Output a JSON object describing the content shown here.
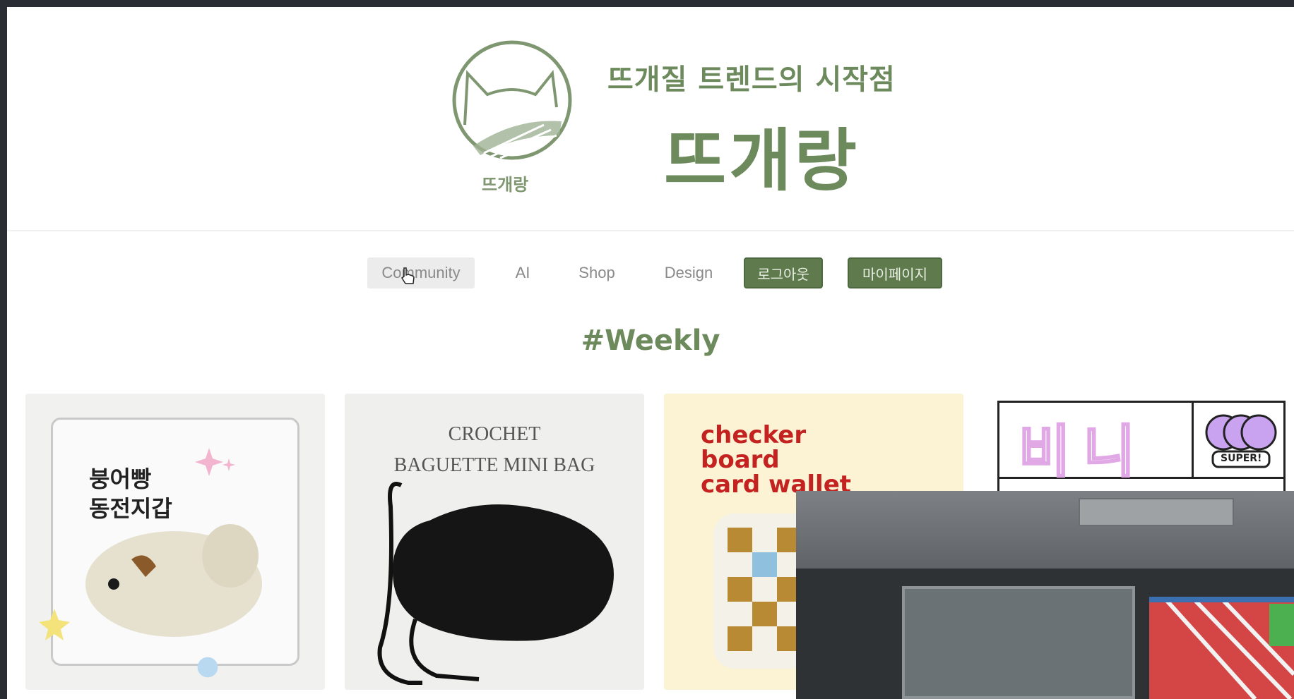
{
  "header": {
    "tagline": "뜨개질 트렌드의 시작점",
    "brand": "뜨개랑",
    "logo_caption": "뜨개랑"
  },
  "nav": {
    "items": [
      {
        "label": "Community",
        "active": true
      },
      {
        "label": "AI",
        "active": false
      },
      {
        "label": "Shop",
        "active": false
      },
      {
        "label": "Design",
        "active": false
      }
    ],
    "logout_label": "로그아웃",
    "mypage_label": "마이페이지"
  },
  "section": {
    "title": "#Weekly"
  },
  "cards": [
    {
      "text": "붕어빵\n동전지갑"
    },
    {
      "line1": "CROCHET",
      "line2": "BAGUETTE MINI BAG"
    },
    {
      "title": "checker\nboard\ncard wallet"
    },
    {
      "title": "비니",
      "badge": "SUPER!"
    }
  ],
  "colors": {
    "brand_green": "#6d8a5c",
    "button_green": "#5f7a4d",
    "checker_red": "#c42121"
  },
  "icons": [
    "cat-yarn-logo-icon",
    "hand-cursor-icon",
    "smiley-icon"
  ]
}
